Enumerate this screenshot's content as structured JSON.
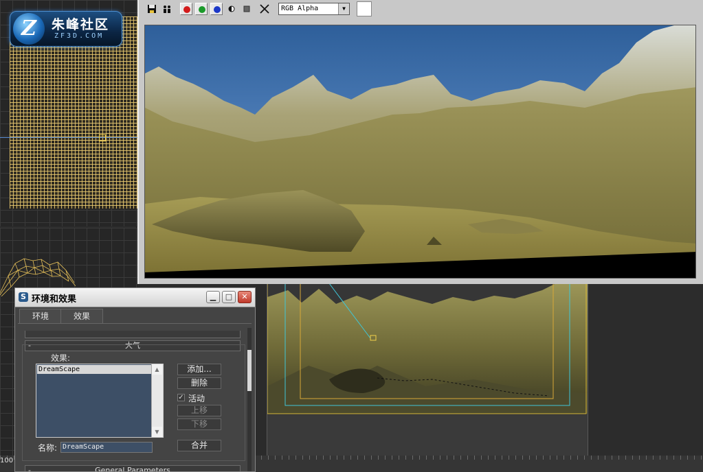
{
  "logo": {
    "title": "朱峰社区",
    "subtitle": "ZF3D.COM"
  },
  "viewport": {
    "ruler_label": "100"
  },
  "render_frame": {
    "toolbar": {
      "save_icon": "floppy-disk-icon",
      "clone_icon": "two-people-icon",
      "red_channel_color": "#d31c1c",
      "green_channel_color": "#1b9a2a",
      "blue_channel_color": "#1c38c8",
      "alpha_icon": "half-circle-icon",
      "mono_icon": "gray-square-icon",
      "clear_icon": "x-icon",
      "channel_value": "RGB Alpha",
      "swatch_color": "#ffffff"
    }
  },
  "dialog": {
    "title": "环境和效果",
    "tabs": [
      "环境",
      "效果"
    ],
    "atmosphere": {
      "header": "大气",
      "effects_label": "效果:",
      "list_items": [
        "DreamScape"
      ],
      "buttons": {
        "add": "添加...",
        "delete": "删除",
        "move_up": "上移",
        "move_down": "下移",
        "merge": "合并"
      },
      "active_label": "活动",
      "active_checked": true,
      "name_label": "名称:",
      "name_value": "DreamScape"
    },
    "general_params_header": "General Parameters",
    "collapse_symbol": "-"
  }
}
